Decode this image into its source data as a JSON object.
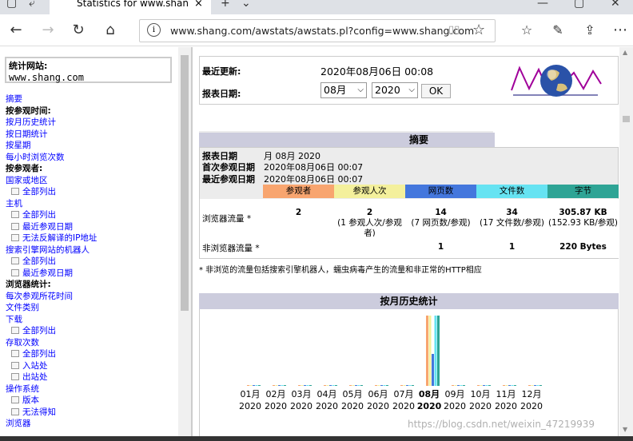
{
  "browser": {
    "tab_title": "Statistics for www.shang",
    "tab_close": "×",
    "new_tab": "+",
    "url": "www.shang.com/awstats/awstats.pl?config=www.shang.com"
  },
  "left": {
    "site_label": "统计网站:",
    "site_value": "www.shang.com",
    "menu": [
      {
        "text": "摘要",
        "kind": "link"
      },
      {
        "text": "按参观时间:",
        "kind": "header"
      },
      {
        "text": "按月历史统计",
        "kind": "link"
      },
      {
        "text": "按日期统计",
        "kind": "link"
      },
      {
        "text": "按星期",
        "kind": "link"
      },
      {
        "text": "每小时浏览次数",
        "kind": "link"
      },
      {
        "text": "按参观者:",
        "kind": "header"
      },
      {
        "text": "国家或地区",
        "kind": "link"
      },
      {
        "text": "全部列出",
        "kind": "sub"
      },
      {
        "text": "主机",
        "kind": "link"
      },
      {
        "text": "全部列出",
        "kind": "sub"
      },
      {
        "text": "最近参观日期",
        "kind": "sub"
      },
      {
        "text": "无法反解译的IP地址",
        "kind": "sub"
      },
      {
        "text": "搜索引擎网站的机器人",
        "kind": "link"
      },
      {
        "text": "全部列出",
        "kind": "sub"
      },
      {
        "text": "最近参观日期",
        "kind": "sub"
      },
      {
        "text": "浏览器统计:",
        "kind": "header"
      },
      {
        "text": "每次参观所花时间",
        "kind": "link"
      },
      {
        "text": "文件类别",
        "kind": "link"
      },
      {
        "text": "下载",
        "kind": "link"
      },
      {
        "text": "全部列出",
        "kind": "sub"
      },
      {
        "text": "存取次数",
        "kind": "link"
      },
      {
        "text": "全部列出",
        "kind": "sub"
      },
      {
        "text": "入站处",
        "kind": "sub"
      },
      {
        "text": "出站处",
        "kind": "sub"
      },
      {
        "text": "操作系统",
        "kind": "link"
      },
      {
        "text": "版本",
        "kind": "sub"
      },
      {
        "text": "无法得知",
        "kind": "sub"
      },
      {
        "text": "浏览器",
        "kind": "link"
      }
    ]
  },
  "update": {
    "last_update_label": "最近更新:",
    "last_update_value": "2020年08月06日 00:08",
    "report_date_label": "报表日期:",
    "month_select": "08月",
    "year_select": "2020",
    "ok_label": "OK"
  },
  "summary": {
    "title": "摘要",
    "report_date_label": "报表日期",
    "report_date_value": "月 08月 2020",
    "first_visit_label": "首次参观日期",
    "first_visit_value": "2020年08月06日 00:07",
    "last_visit_label": "最近参观日期",
    "last_visit_value": "2020年08月06日 00:07",
    "columns": [
      "参观者",
      "参观人次",
      "网页数",
      "文件数",
      "字节"
    ],
    "column_colors": [
      "#f8a56f",
      "#f4f09c",
      "#4477dd",
      "#66e3f2",
      "#2ea495"
    ],
    "browser_row_label": "浏览器流量 *",
    "browser_row": [
      {
        "main": "2",
        "sub": ""
      },
      {
        "main": "2",
        "sub": "(1 参观人次/参观者)"
      },
      {
        "main": "14",
        "sub": "(7 网页数/参观)"
      },
      {
        "main": "34",
        "sub": "(17 文件数/参观)"
      },
      {
        "main": "305.87 KB",
        "sub": "(152.93 KB/参观)"
      }
    ],
    "non_browser_row_label": "非浏览器流量 *",
    "non_browser_row": [
      "",
      "",
      "1",
      "1",
      "220 Bytes"
    ],
    "note": "* 非浏览的流量包括搜索引擎机器人，蠕虫病毒产生的流量和非正常的HTTP相应"
  },
  "monthly": {
    "title": "按月历史统计",
    "months": [
      "01月",
      "02月",
      "03月",
      "04月",
      "05月",
      "06月",
      "07月",
      "08月",
      "09月",
      "10月",
      "11月",
      "12月"
    ],
    "year": "2020",
    "current_index": 7
  },
  "watermark": "https://blog.csdn.net/weixin_47219939"
}
